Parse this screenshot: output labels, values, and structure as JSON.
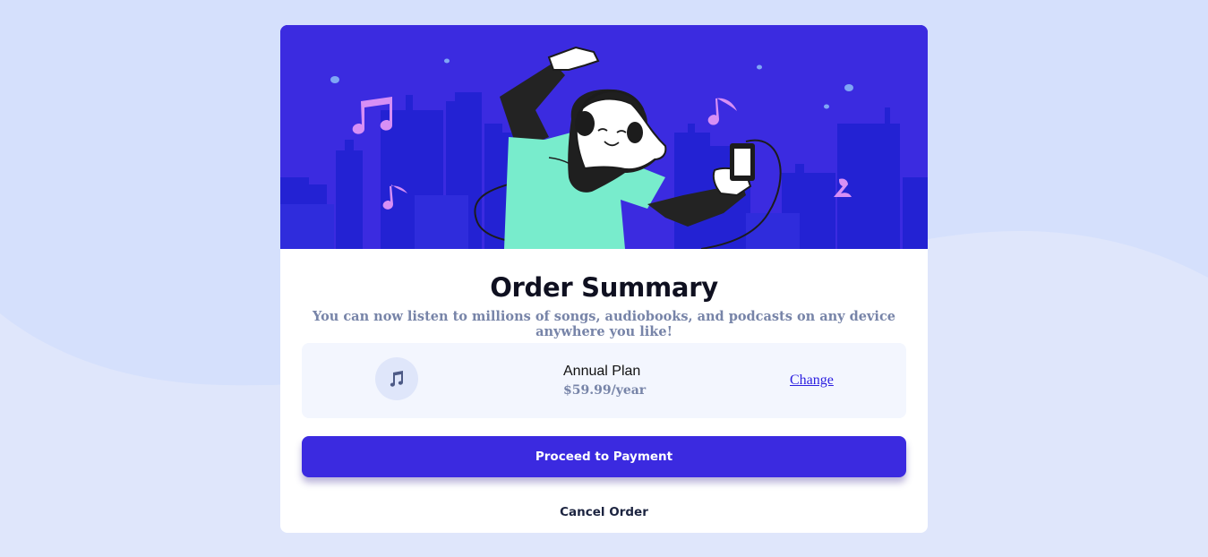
{
  "colors": {
    "background": "#dfe6fb",
    "accent": "#3b2ae0",
    "card": "#ffffff",
    "muted_text": "#7784a8",
    "plan_box": "#f3f6fe"
  },
  "hero": {
    "illustration": "person-dancing-with-headphones-illustration"
  },
  "summary": {
    "title": "Order Summary",
    "subtitle": "You can now listen to millions of songs, audiobooks, and podcasts on any device anywhere you like!"
  },
  "plan": {
    "icon": "music-note-icon",
    "name": "Annual Plan",
    "price": "$59.99/year",
    "change_label": "Change"
  },
  "actions": {
    "proceed_label": "Proceed to Payment",
    "cancel_label": "Cancel Order"
  }
}
